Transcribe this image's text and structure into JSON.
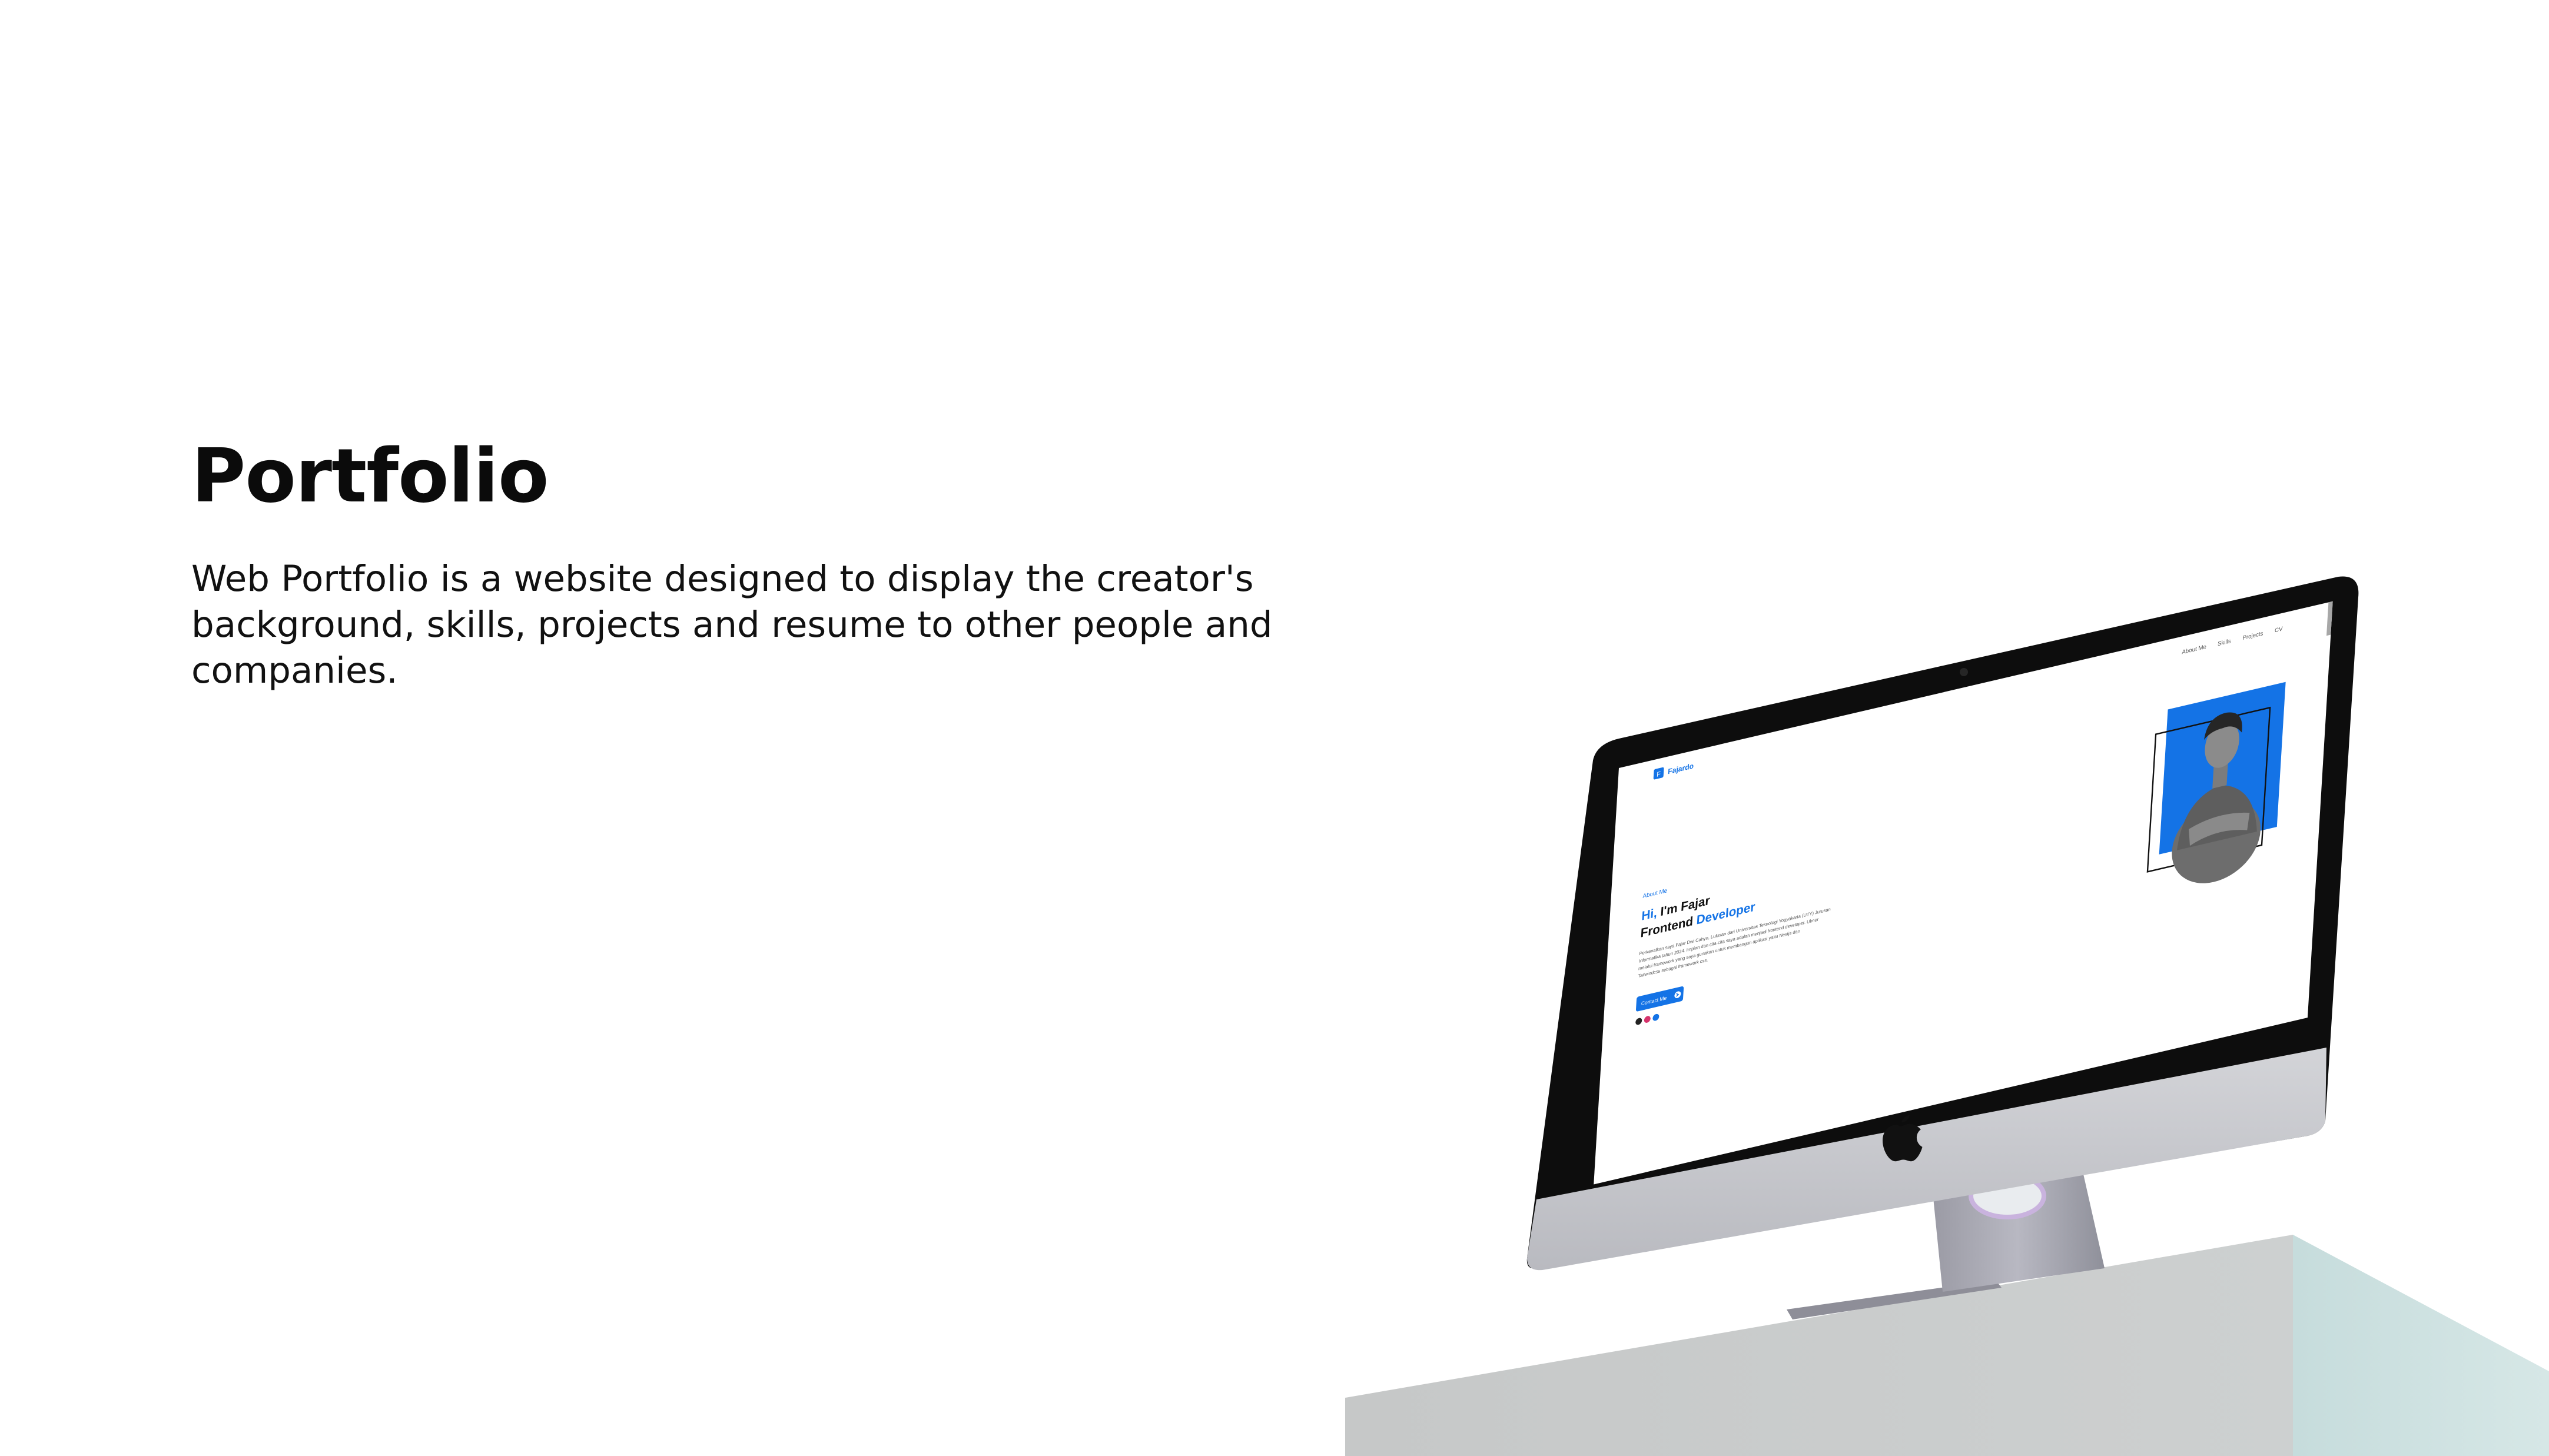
{
  "slide": {
    "title": "Portfolio",
    "description": "Web Portfolio is a website designed to display the creator's background, skills, projects and resume to other people and companies."
  },
  "mock_site": {
    "brand_initial": "F",
    "brand_name": "Fajardo",
    "nav": [
      "About Me",
      "Skills",
      "Projects",
      "CV"
    ],
    "eyebrow": "About Me",
    "greeting_highlight": "Hi,",
    "greeting_rest": " I'm Fajar",
    "role_plain": "Frontend ",
    "role_highlight": "Developer",
    "bio": [
      "Perkenalkan saya Fajar Dwi Cahyo, Lulusan dari Universitas Teknologi Yogyakarta (UTY) Jurusan",
      "Informatika tahun 2024. Impian dan cita-cita saya adalah menjadi frontend developer. Ulmer",
      "melalui framework yang saya gunakan untuk membangun aplikasi yaitu Nextjs dan",
      "Tailwindcss sebagai framework css."
    ],
    "cta_label": "Contact Me",
    "social_icons": [
      "github-icon",
      "instagram-icon",
      "linkedin-icon"
    ]
  },
  "colors": {
    "accent": "#1473e6",
    "bezel": "#0d0d0d",
    "chin": "#c4c5c9",
    "pedestal_front": "#c9cccc",
    "pedestal_side": "#cfe3e2"
  }
}
